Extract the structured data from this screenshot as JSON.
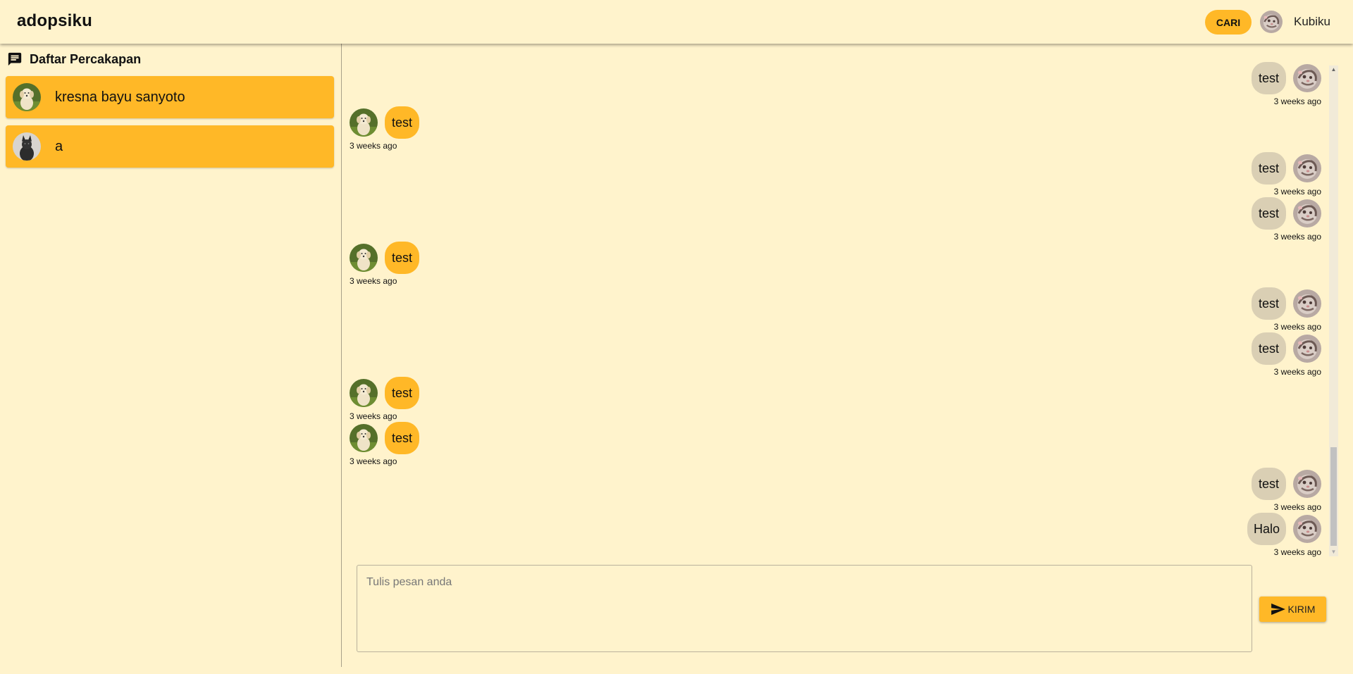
{
  "app": {
    "brand": "adopsiku"
  },
  "header": {
    "search_button": "CARI",
    "user_name": "Kubiku"
  },
  "sidebar": {
    "title": "Daftar Percakapan",
    "conversations": [
      {
        "name": "kresna bayu sanyoto",
        "avatar": "golden-puppy-avatar"
      },
      {
        "name": "a",
        "avatar": "black-dog-avatar"
      }
    ]
  },
  "messages": [
    {
      "side": "right",
      "text": "test",
      "time": "3 weeks ago"
    },
    {
      "side": "left",
      "text": "test",
      "time": "3 weeks ago"
    },
    {
      "side": "right",
      "text": "test",
      "time": "3 weeks ago"
    },
    {
      "side": "right",
      "text": "test",
      "time": "3 weeks ago"
    },
    {
      "side": "left",
      "text": "test",
      "time": "3 weeks ago"
    },
    {
      "side": "right",
      "text": "test",
      "time": "3 weeks ago"
    },
    {
      "side": "right",
      "text": "test",
      "time": "3 weeks ago"
    },
    {
      "side": "left",
      "text": "test",
      "time": "3 weeks ago"
    },
    {
      "side": "left",
      "text": "test",
      "time": "3 weeks ago"
    },
    {
      "side": "right",
      "text": "test",
      "time": "3 weeks ago"
    },
    {
      "side": "right",
      "text": "Halo",
      "time": "3 weeks ago"
    }
  ],
  "composer": {
    "placeholder": "Tulis pesan anda",
    "send_label": "KIRIM"
  },
  "colors": {
    "background": "#fff3cc",
    "accent": "#ffb827",
    "bubble_own": "#dacfb4"
  }
}
